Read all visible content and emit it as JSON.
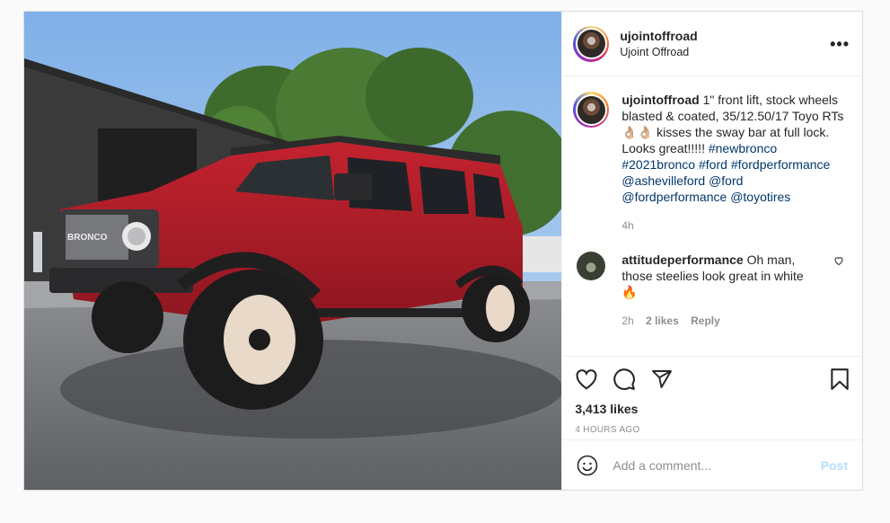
{
  "post": {
    "username": "ujointoffroad",
    "fullname": "Ujoint Offroad",
    "more_label": "•••",
    "caption": {
      "username": "ujointoffroad",
      "text_1": "1\" front lift, stock wheels blasted & coated, 35/12.50/17 Toyo RTs",
      "emoji": "👌🏼👌🏼",
      "text_2": "kisses the sway bar at full lock. Looks great!!!!!",
      "tags_1": [
        "#newbronco"
      ],
      "tags_2": [
        "#2021bronco",
        "#ford",
        "#fordperformance"
      ],
      "tags_3": [
        "@ashevilleford",
        "@ford"
      ],
      "tags_4": [
        "@fordperformance",
        "@toyotires"
      ],
      "time": "4h"
    },
    "comment": {
      "username": "attitudeperformance",
      "text": "Oh man, those steelies look great in white",
      "emoji": "🔥",
      "time": "2h",
      "likes": "2 likes",
      "reply": "Reply"
    },
    "likes": "3,413 likes",
    "time_ago": "4 HOURS AGO",
    "add_comment_placeholder": "Add a comment...",
    "post_button": "Post"
  },
  "colors": {
    "link": "#00376b",
    "post_button": "#b2dffc",
    "meta": "#8e8e8e"
  },
  "icons": [
    "more-icon",
    "heart-icon",
    "comment-icon",
    "share-icon",
    "bookmark-icon",
    "emoji-icon"
  ]
}
